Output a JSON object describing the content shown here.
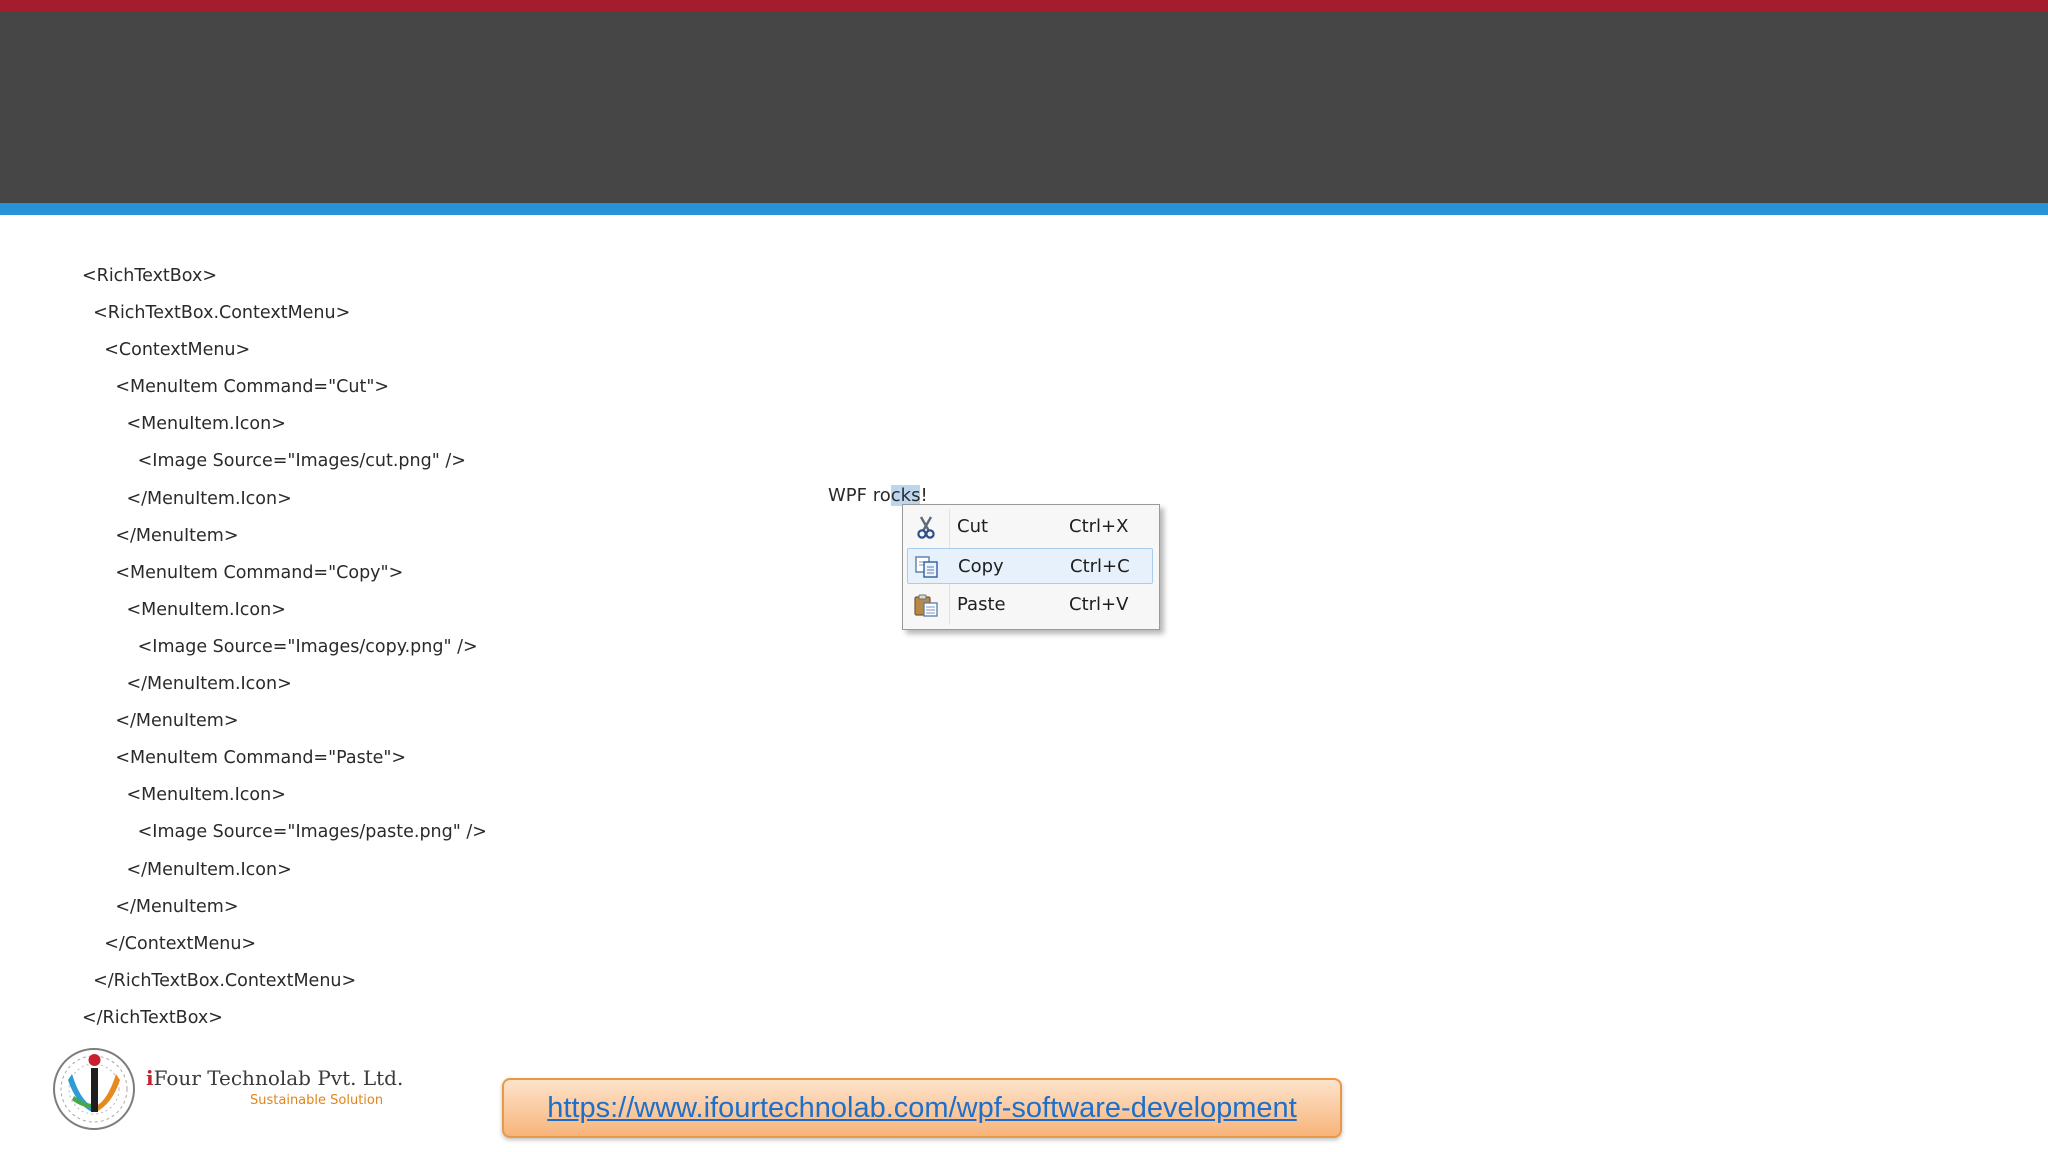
{
  "code_lines": [
    "<RichTextBox>",
    "  <RichTextBox.ContextMenu>",
    "    <ContextMenu>",
    "      <MenuItem Command=\"Cut\">",
    "        <MenuItem.Icon>",
    "          <Image Source=\"Images/cut.png\" />",
    "        </MenuItem.Icon>",
    "      </MenuItem>",
    "      <MenuItem Command=\"Copy\">",
    "        <MenuItem.Icon>",
    "          <Image Source=\"Images/copy.png\" />",
    "        </MenuItem.Icon>",
    "      </MenuItem>",
    "      <MenuItem Command=\"Paste\">",
    "        <MenuItem.Icon>",
    "          <Image Source=\"Images/paste.png\" />",
    "        </MenuItem.Icon>",
    "      </MenuItem>",
    "    </ContextMenu>",
    "  </RichTextBox.ContextMenu>",
    "</RichTextBox>"
  ],
  "demo": {
    "text_before": "WPF ro",
    "text_selected": "cks",
    "text_after": "!"
  },
  "context_menu": {
    "items": [
      {
        "label": "Cut",
        "shortcut": "Ctrl+X",
        "icon": "scissors-icon"
      },
      {
        "label": "Copy",
        "shortcut": "Ctrl+C",
        "icon": "copy-icon",
        "highlighted": true
      },
      {
        "label": "Paste",
        "shortcut": "Ctrl+V",
        "icon": "paste-icon"
      }
    ]
  },
  "footer": {
    "company_initial": "i",
    "company_rest": "Four Technolab Pvt. Ltd.",
    "tagline": "Sustainable Solution",
    "url": "https://www.ifourtechnolab.com/wpf-software-development"
  },
  "colors": {
    "top_bar": "#a31d2e",
    "header": "#464646",
    "rule": "#2593d6",
    "link": "#1f6fc8",
    "url_box_border": "#ea9848"
  }
}
